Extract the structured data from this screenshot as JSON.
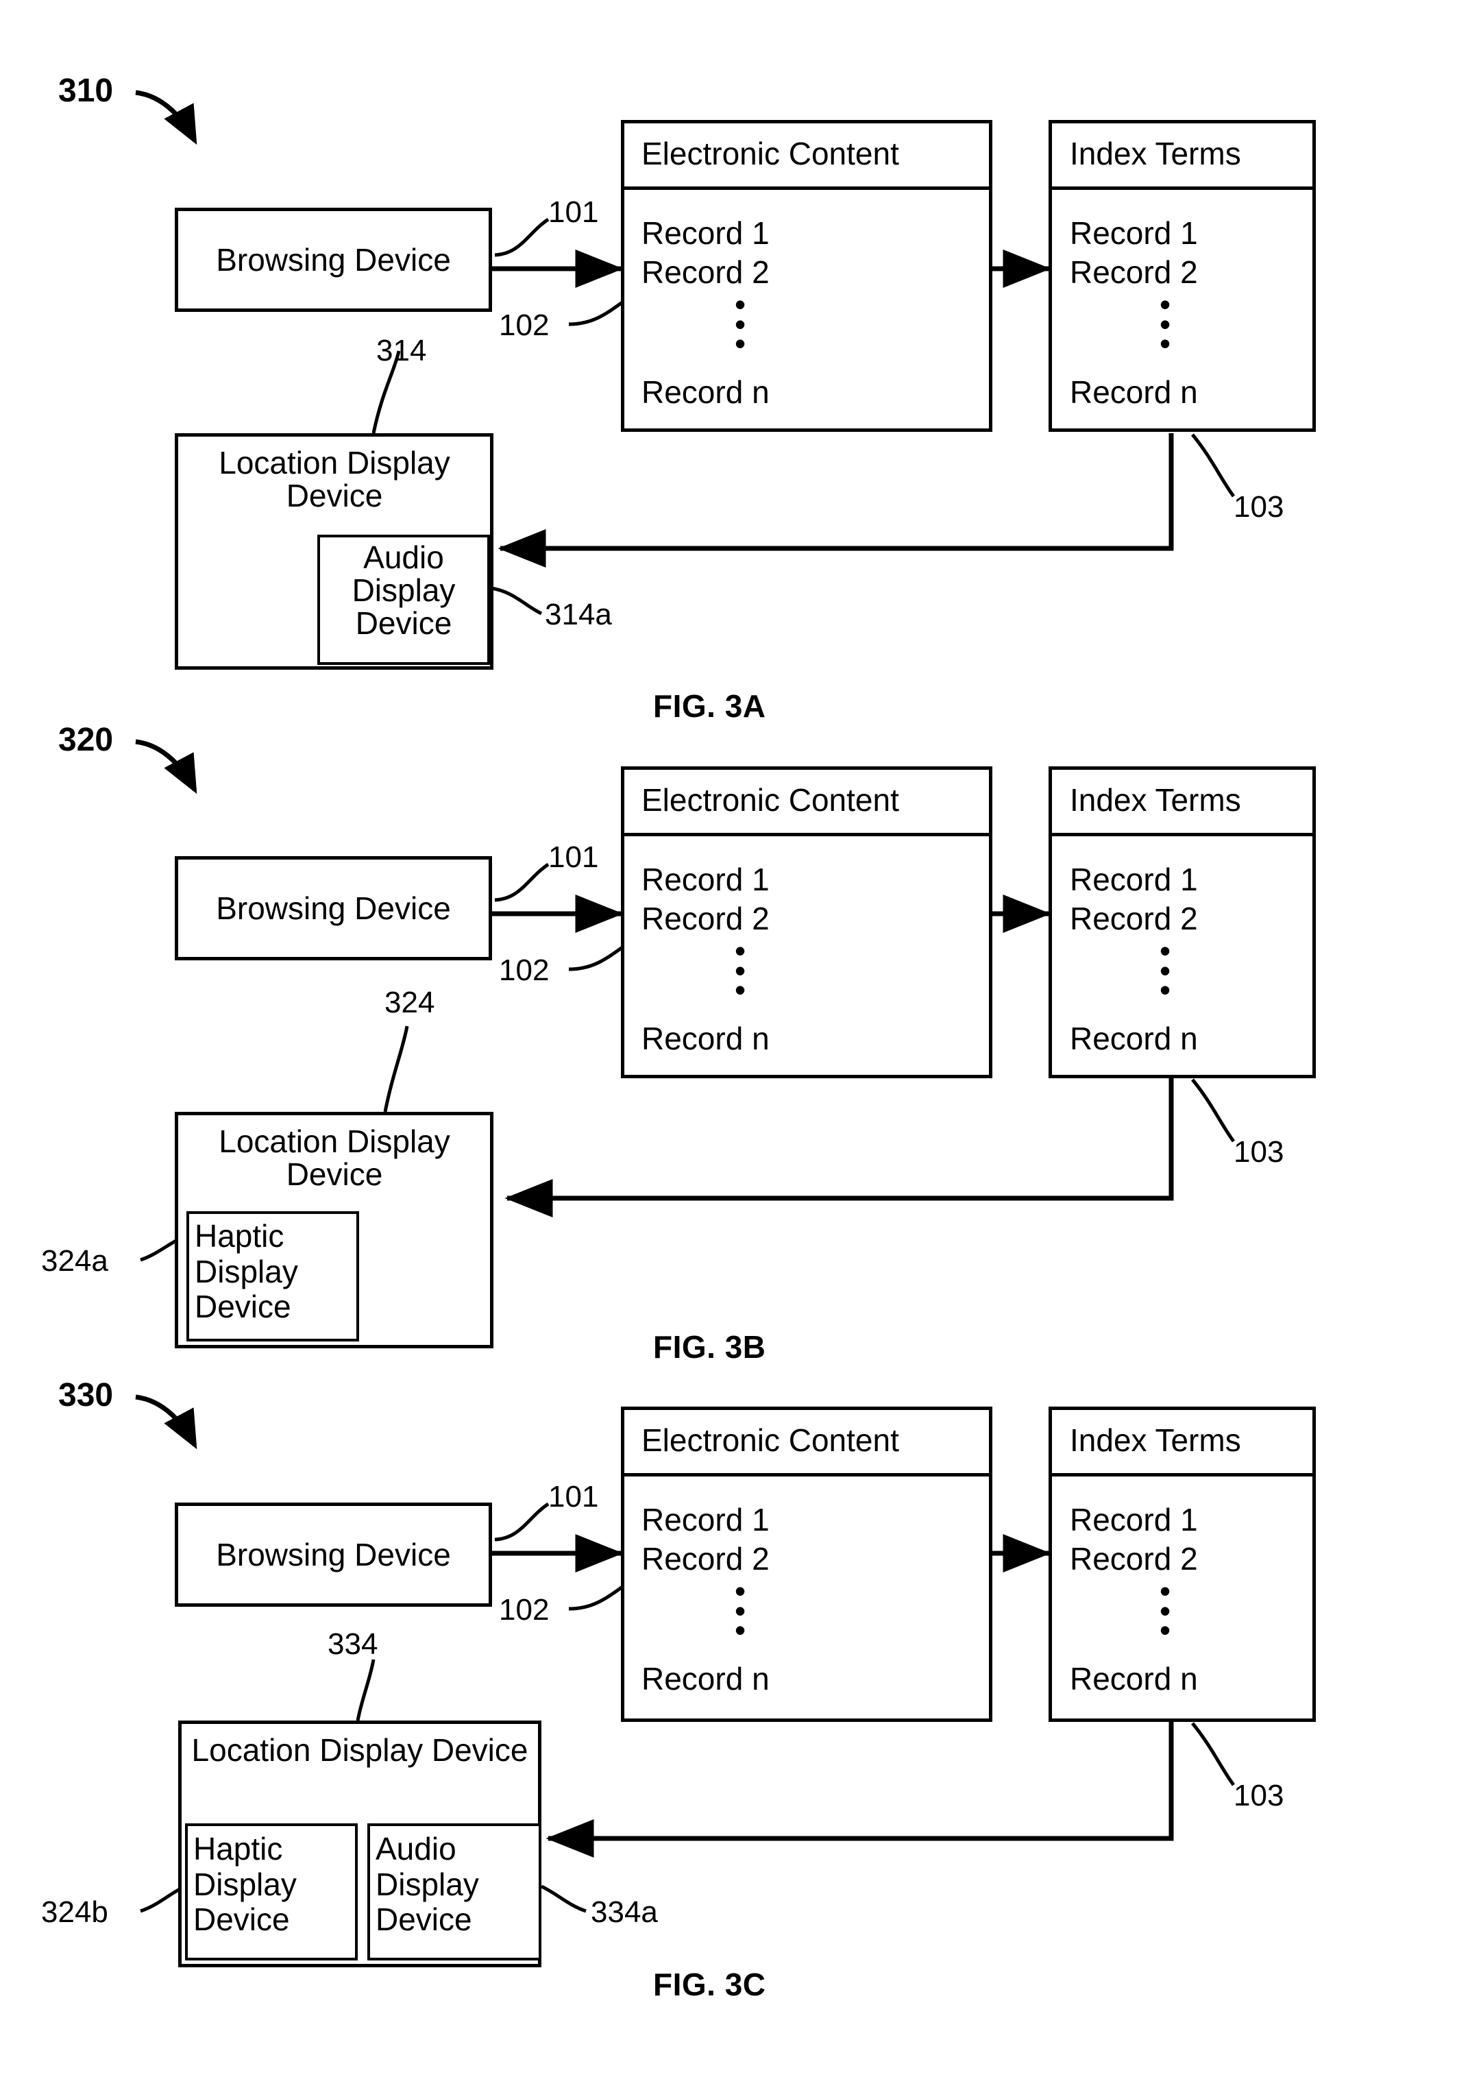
{
  "document": {
    "type": "patent-figure-sheet",
    "figures": [
      {
        "id": "fig-3a",
        "figure_number": "310",
        "caption": "FIG. 3A",
        "browsing_device": {
          "label": "Browsing Device",
          "ref": "314"
        },
        "electronic_content": {
          "title": "Electronic Content",
          "records": [
            "Record 1",
            "Record 2",
            "Record n"
          ]
        },
        "index_terms": {
          "title": "Index Terms",
          "records": [
            "Record 1",
            "Record 2",
            "Record n"
          ]
        },
        "location_display_device": {
          "label": "Location Display Device",
          "sub_devices": [
            {
              "label": "Audio Display Device",
              "ref": "314a"
            }
          ]
        },
        "connector_refs": {
          "request": "101",
          "content": "102",
          "feedback": "103"
        }
      },
      {
        "id": "fig-3b",
        "figure_number": "320",
        "caption": "FIG. 3B",
        "browsing_device": {
          "label": "Browsing Device",
          "ref": "324"
        },
        "electronic_content": {
          "title": "Electronic Content",
          "records": [
            "Record 1",
            "Record 2",
            "Record n"
          ]
        },
        "index_terms": {
          "title": "Index Terms",
          "records": [
            "Record 1",
            "Record 2",
            "Record n"
          ]
        },
        "location_display_device": {
          "label": "Location Display Device",
          "sub_devices": [
            {
              "label": "Haptic Display Device",
              "ref": "324a"
            }
          ]
        },
        "connector_refs": {
          "request": "101",
          "content": "102",
          "feedback": "103"
        }
      },
      {
        "id": "fig-3c",
        "figure_number": "330",
        "caption": "FIG. 3C",
        "browsing_device": {
          "label": "Browsing Device",
          "ref": "334"
        },
        "electronic_content": {
          "title": "Electronic Content",
          "records": [
            "Record 1",
            "Record 2",
            "Record n"
          ]
        },
        "index_terms": {
          "title": "Index Terms",
          "records": [
            "Record 1",
            "Record 2",
            "Record n"
          ]
        },
        "location_display_device": {
          "label": "Location Display Device",
          "sub_devices": [
            {
              "label": "Haptic Display Device",
              "ref": "324b"
            },
            {
              "label": "Audio Display Device",
              "ref": "334a"
            }
          ]
        },
        "connector_refs": {
          "request": "101",
          "content": "102",
          "feedback": "103"
        }
      }
    ],
    "colors": {
      "ink": "#000000",
      "paper": "#ffffff"
    }
  }
}
